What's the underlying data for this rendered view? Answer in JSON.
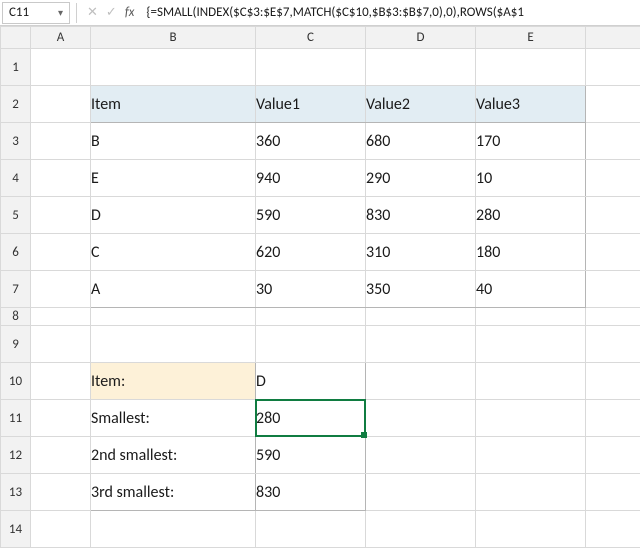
{
  "nameBox": {
    "value": "C11"
  },
  "formulaBar": {
    "icons": {
      "cancel": "✕",
      "enter": "✓",
      "fx": "fx"
    },
    "text": "{=SMALL(INDEX($C$3:$E$7,MATCH($C$10,$B$3:$B$7,0),0),ROWS($A$1"
  },
  "columns": [
    "A",
    "B",
    "C",
    "D",
    "E"
  ],
  "rows": [
    "1",
    "2",
    "3",
    "4",
    "5",
    "6",
    "7",
    "8",
    "9",
    "10",
    "11",
    "12",
    "13",
    "14"
  ],
  "table": {
    "headers": {
      "item": "Item",
      "v1": "Value1",
      "v2": "Value2",
      "v3": "Value3"
    },
    "data": [
      {
        "item": "B",
        "v1": "360",
        "v2": "680",
        "v3": "170"
      },
      {
        "item": "E",
        "v1": "940",
        "v2": "290",
        "v3": "10"
      },
      {
        "item": "D",
        "v1": "590",
        "v2": "830",
        "v3": "280"
      },
      {
        "item": "C",
        "v1": "620",
        "v2": "310",
        "v3": "180"
      },
      {
        "item": "A",
        "v1": "30",
        "v2": "350",
        "v3": "40"
      }
    ]
  },
  "lookup": {
    "itemLabel": "Item:",
    "itemValue": "D",
    "rows": [
      {
        "label": "Smallest:",
        "value": "280"
      },
      {
        "label": "2nd smallest:",
        "value": "590"
      },
      {
        "label": "3rd smallest:",
        "value": "830"
      }
    ]
  },
  "activeCell": "C11"
}
